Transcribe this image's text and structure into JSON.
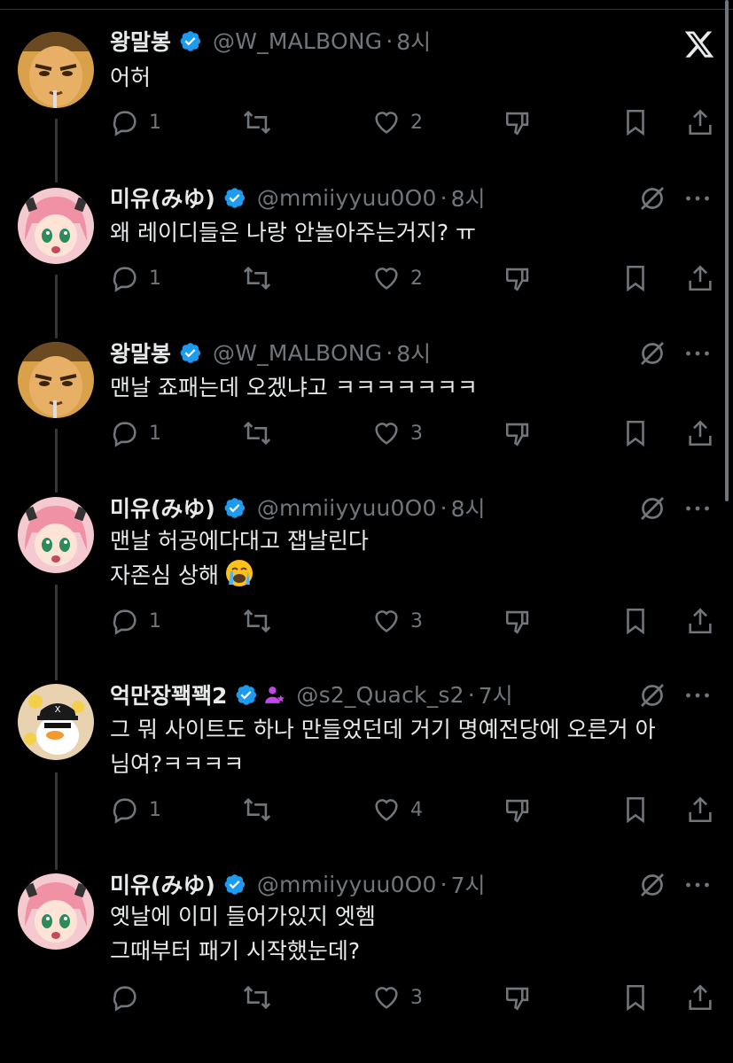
{
  "colors": {
    "background": "#000000",
    "text": "#e7e9ea",
    "muted": "#71767b",
    "verified": "#1d9bf0",
    "thread_line": "#333639"
  },
  "header": {
    "close_icon": "x-logo-icon"
  },
  "tweets": [
    {
      "name": "왕말봉",
      "handle": "@W_MALBONG",
      "sep": "·",
      "time": "8시",
      "lines": [
        "어허"
      ],
      "replies": "1",
      "likes": "2",
      "avatar": "man-cartoon-avatar",
      "has_grok": false
    },
    {
      "name": "미유(みゆ)",
      "handle": "@mmiiyyuu0O0",
      "sep": "·",
      "time": "8시",
      "lines": [
        "왜 레이디들은 나랑 안놀아주는거지? ㅠ"
      ],
      "replies": "1",
      "likes": "2",
      "avatar": "pink-hair-girl-avatar",
      "has_grok": true
    },
    {
      "name": "왕말봉",
      "handle": "@W_MALBONG",
      "sep": "·",
      "time": "8시",
      "lines": [
        "맨날 죠패는데 오겠냐고 ㅋㅋㅋㅋㅋㅋㅋ"
      ],
      "replies": "1",
      "likes": "3",
      "avatar": "man-cartoon-avatar",
      "has_grok": true
    },
    {
      "name": "미유(みゆ)",
      "handle": "@mmiiyyuu0O0",
      "sep": "·",
      "time": "8시",
      "lines": [
        "맨날 허공에다대고 잽날린다",
        "자존심 상해"
      ],
      "replies": "1",
      "likes": "3",
      "avatar": "pink-hair-girl-avatar",
      "has_grok": true,
      "emoji": "crying-face-emoji"
    },
    {
      "name": "억만장꽥꽥2",
      "handle": "@s2_Quack_s2",
      "sep": "·",
      "time": "7시",
      "lines": [
        "그 뭐 사이트도 하나 만들었던데 거기 명예전당에 오른거 아",
        "님여?ㅋㅋㅋㅋ"
      ],
      "replies": "1",
      "likes": "4",
      "avatar": "duck-avatar",
      "has_grok": true
    },
    {
      "name": "미유(みゆ)",
      "handle": "@mmiiyyuu0O0",
      "sep": "·",
      "time": "7시",
      "lines": [
        "옛날에 이미 들어가있지 엣헴",
        "그때부터 패기 시작했눈데?"
      ],
      "replies": "",
      "likes": "3",
      "avatar": "pink-hair-girl-avatar",
      "has_grok": true
    }
  ]
}
